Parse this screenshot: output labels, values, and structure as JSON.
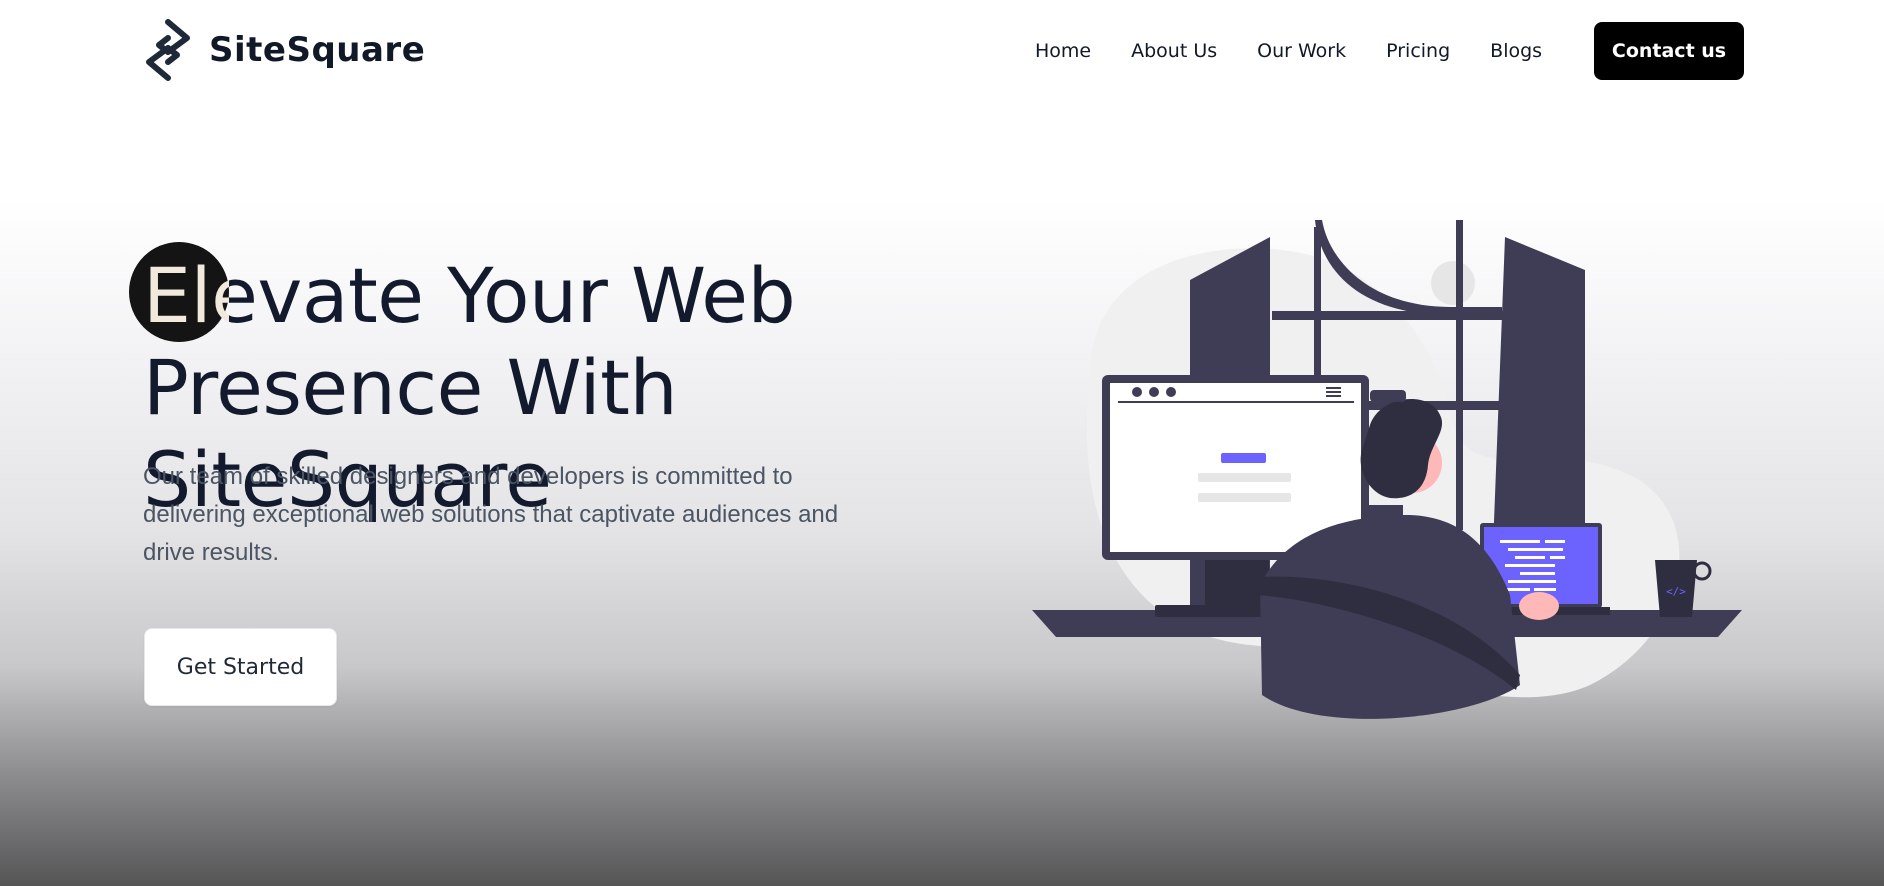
{
  "brand": {
    "name": "SiteSquare",
    "logo_icon": "sitesquare-logo-icon"
  },
  "nav": {
    "items": [
      {
        "label": "Home"
      },
      {
        "label": "About Us"
      },
      {
        "label": "Our Work"
      },
      {
        "label": "Pricing"
      },
      {
        "label": "Blogs"
      }
    ],
    "cta_label": "Contact us"
  },
  "hero": {
    "title_line1": "Elevate Your Web",
    "title_line2": "Presence With SiteSquare",
    "description": "Our team of skilled designers and developers is committed to delivering exceptional web solutions that captivate audiences and drive results.",
    "button_label": "Get Started"
  },
  "colors": {
    "text_dark": "#141a2e",
    "accent_purple": "#6c63ff",
    "illustration_dark": "#3f3d56",
    "skin": "#ffb8b8"
  }
}
